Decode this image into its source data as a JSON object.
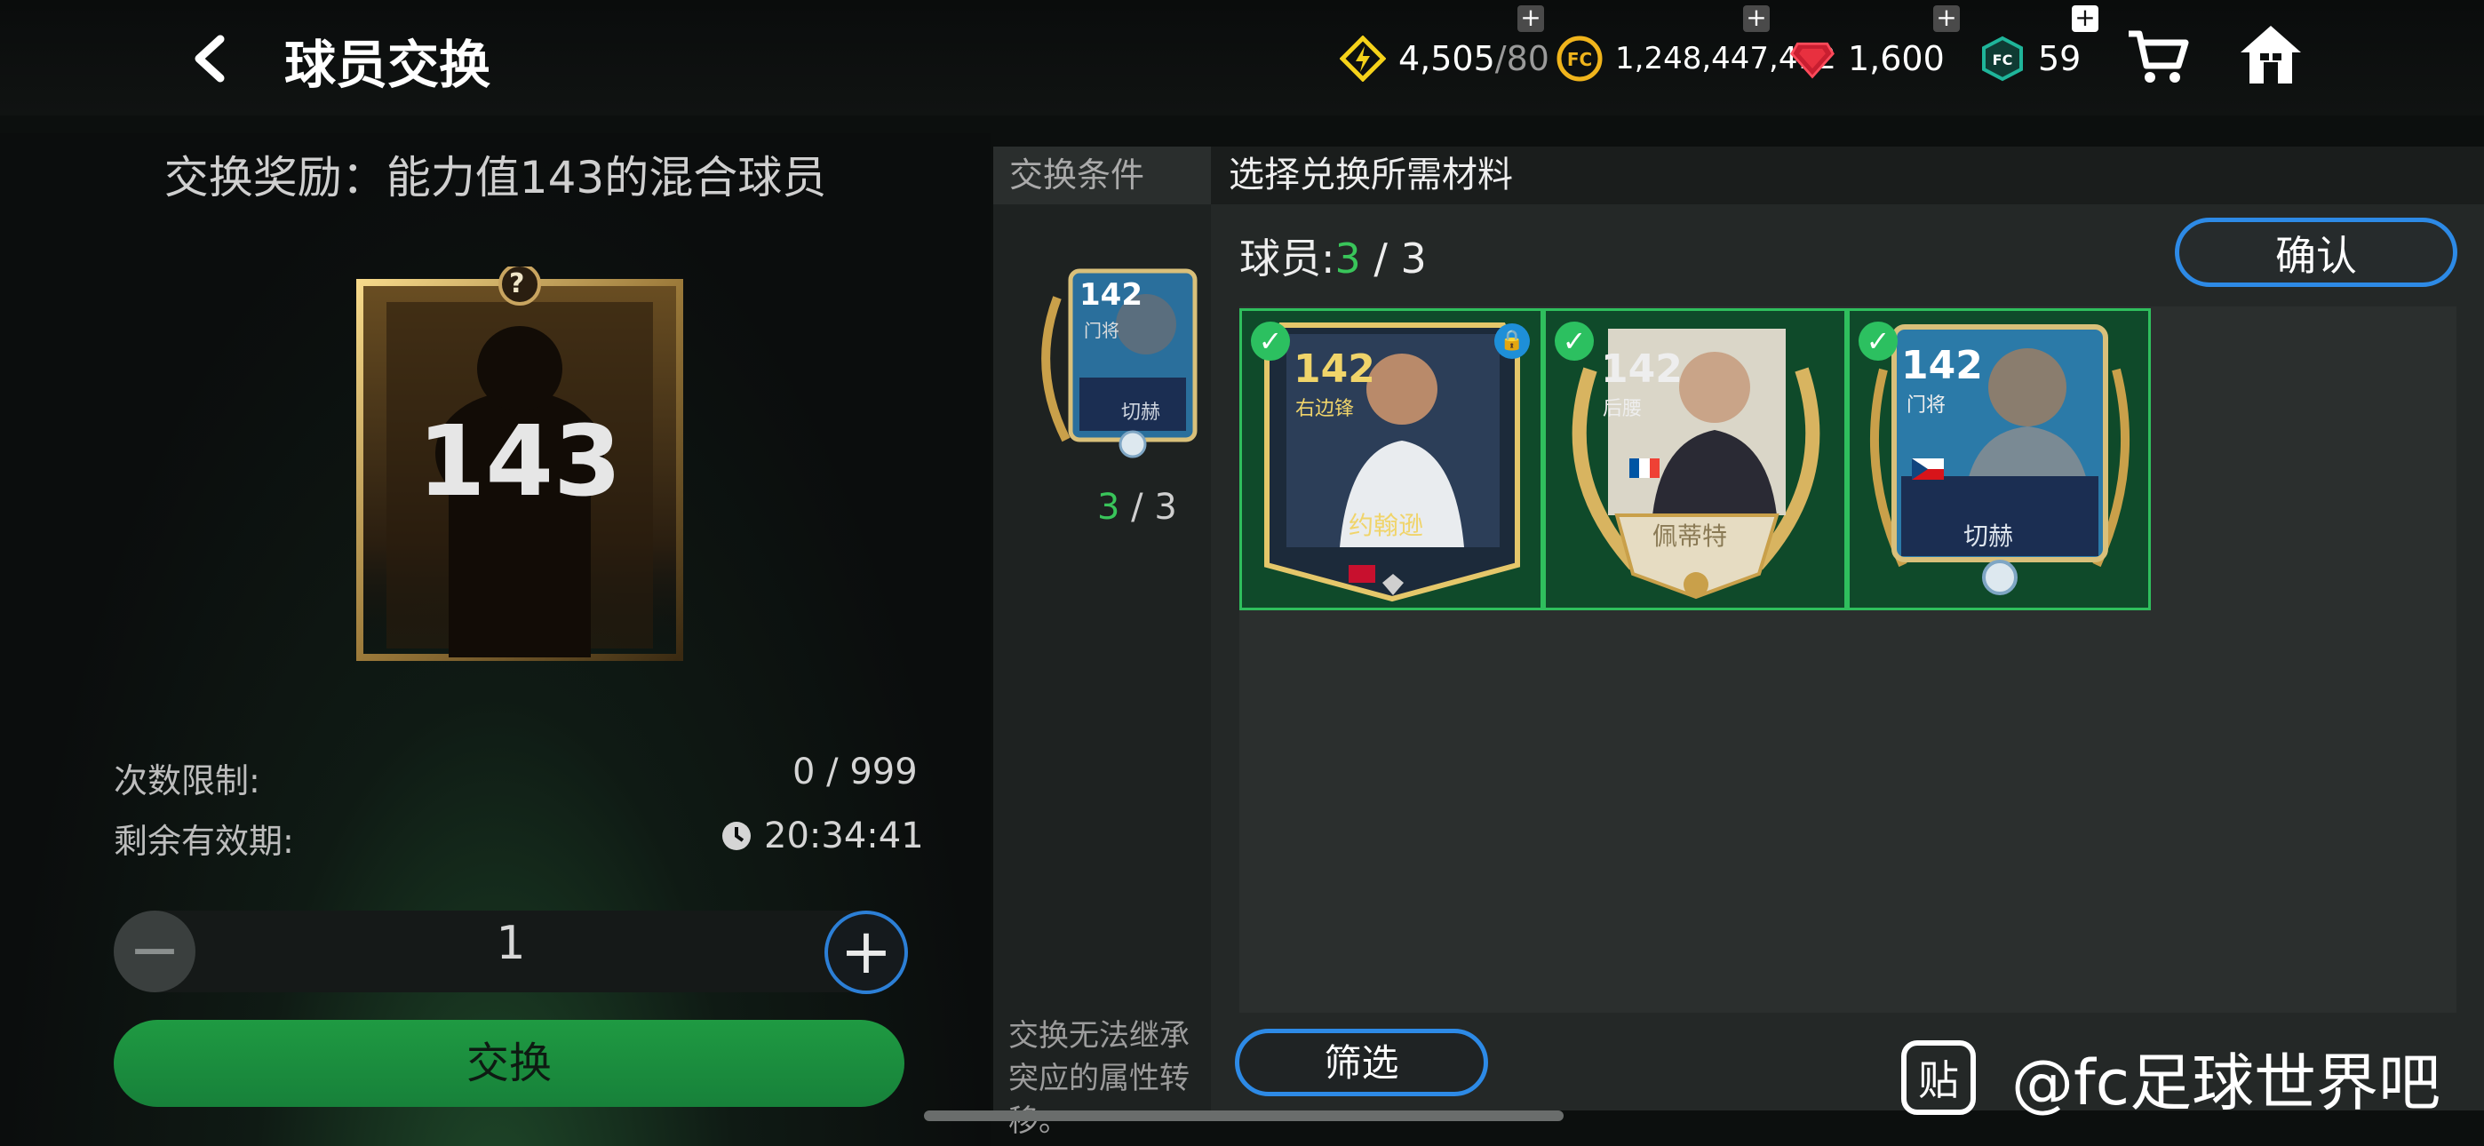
{
  "header": {
    "back_icon": "chevron-left-icon",
    "title": "球员交换",
    "resources": [
      {
        "name": "energy",
        "icon": "lightning-icon",
        "value": "4,505",
        "suffix": "/80",
        "color": "#f5d21a"
      },
      {
        "name": "coins",
        "icon": "fc-coin-icon",
        "value": "1,248,447,412",
        "color": "#f0b41c"
      },
      {
        "name": "gems",
        "icon": "ruby-icon",
        "value": "1,600",
        "color": "#e0283a"
      },
      {
        "name": "fc-points",
        "icon": "fc-shield-icon",
        "value": "59",
        "color": "#1fb59a"
      }
    ],
    "cart_icon": "cart-icon",
    "home_icon": "home-icon"
  },
  "left": {
    "reward_title": "交换奖励：能力值143的混合球员",
    "card_rating": "143",
    "card_mark": "?",
    "limit_label": "次数限制:",
    "limit_value": "0 / 999",
    "validity_label": "剩余有效期:",
    "validity_value": "20:34:41",
    "quantity": "1",
    "exchange_label": "交换"
  },
  "middle": {
    "tab": "交换条件",
    "card_rating": "142",
    "card_pos": "门将",
    "card_name": "切赫",
    "count_done": "3",
    "count_total": " / 3",
    "note": "交换无法继承突应的属性转移。"
  },
  "right": {
    "tab": "选择兑换所需材料",
    "players_label": "球员:",
    "players_done": "3",
    "players_total": " / 3",
    "confirm_label": "确认",
    "filter_label": "筛选",
    "cards": [
      {
        "rating": "142",
        "pos": "右边锋",
        "name": "约翰逊",
        "flag": "wales",
        "locked": true
      },
      {
        "rating": "142",
        "pos": "后腰",
        "name": "佩蒂特",
        "flag": "france",
        "locked": false
      },
      {
        "rating": "142",
        "pos": "门将",
        "name": "切赫",
        "flag": "czech",
        "locked": false
      }
    ]
  },
  "watermark": {
    "icon_text": "贴",
    "text": "@fc足球世界吧"
  }
}
